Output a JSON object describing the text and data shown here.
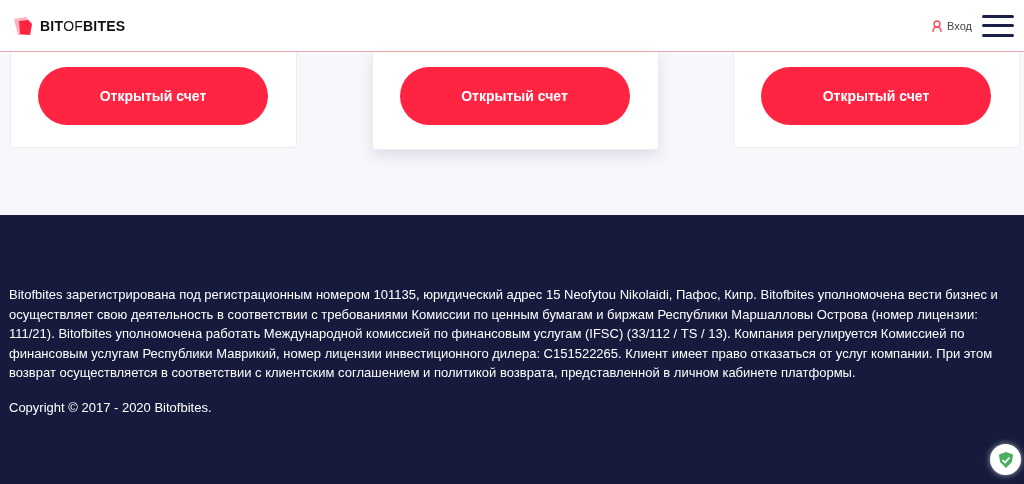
{
  "header": {
    "logo": "**BIT**OF**BITES**",
    "login": "Вход"
  },
  "cards": [
    {
      "button": "Открытый счет",
      "highlighted": false
    },
    {
      "button": "Открытый счет",
      "highlighted": true
    },
    {
      "button": "Открытый счет",
      "highlighted": false
    }
  ],
  "footer": {
    "legal": "Bitofbites зарегистрирована под регистрационным номером 101135, юридический адрес 15 Neofytou Nikolaidi, Пафос, Кипр. Bitofbites уполномочена вести бизнес и осуществляет свою деятельность в соответствии с требованиями Комиссии по ценным бумагам и биржам Республики Маршалловы Острова (номер лицензии: 111/21). Bitofbites уполномочена работать Международной комиссией по финансовым услугам (IFSC) (33/112 / TS / 13). Компания регулируется Комиссией по финансовым услугам Республики Маврикий, номер лицензии инвестиционного дилера: C151522265. Клиент имеет право отказаться от услуг компании. При этом возврат осуществляется в соответствии с клиентским соглашением и политикой возврата, представленной в личном кабинете платформы.",
    "copyright": "Copyright © 2017 - 2020 Bitofbites."
  }
}
